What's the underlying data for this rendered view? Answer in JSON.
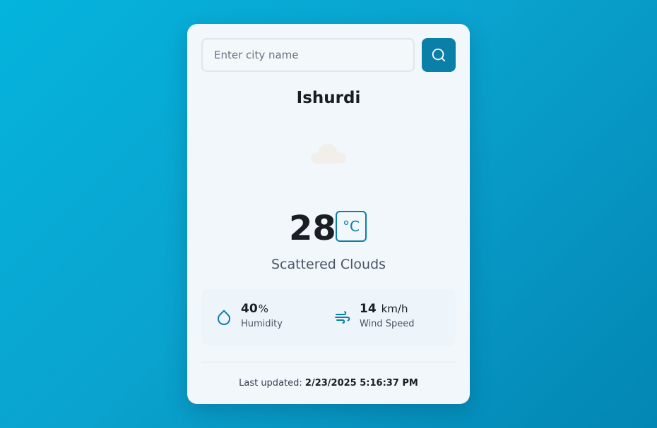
{
  "search": {
    "placeholder": "Enter city name",
    "value": ""
  },
  "location": {
    "city": "Ishurdi"
  },
  "weather": {
    "icon": "cloud-icon",
    "temperature": "28",
    "unit": "°C",
    "description": "Scattered Clouds"
  },
  "stats": {
    "humidity": {
      "value": "40",
      "unit": "%",
      "label": "Humidity",
      "icon": "droplet-icon"
    },
    "wind": {
      "value": "14",
      "unit": "km/h",
      "label": "Wind Speed",
      "icon": "wind-icon"
    }
  },
  "footer": {
    "label": "Last updated:",
    "timestamp": "2/23/2025 5:16:37 PM"
  },
  "colors": {
    "accent": "#0a7fa8",
    "background_start": "#04b4dc",
    "background_end": "#0386b3",
    "card": "#f1f7fb",
    "text_primary": "#1a1d24",
    "text_secondary": "#4b5563"
  }
}
